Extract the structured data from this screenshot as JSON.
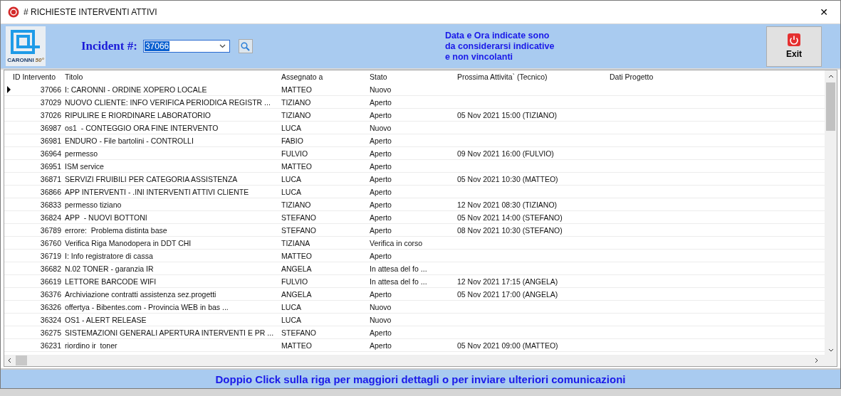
{
  "window": {
    "title": "# RICHIESTE INTERVENTI ATTIVI",
    "close": "✕"
  },
  "header": {
    "logo_text": "CARONNI",
    "logo_badge": "50°",
    "incident_label": "Incident #:",
    "incident_value": "37066",
    "notice": [
      "Data e Ora indicate sono",
      "da considerarsi indicative",
      "e non vincolanti"
    ],
    "exit_label": "Exit"
  },
  "table": {
    "columns": [
      "ID Intervento",
      "Titolo",
      "Assegnato a",
      "Stato",
      "Prossima Attivita` (Tecnico)",
      "Dati Progetto"
    ],
    "rows": [
      {
        "id": "37066",
        "title": "I: CARONNI - ORDINE XOPERO LOCALE",
        "assigned": "MATTEO",
        "state": "Nuovo",
        "next": "",
        "selected": true
      },
      {
        "id": "37029",
        "title": "NUOVO CLIENTE: INFO VERIFICA PERIODICA REGISTR ...",
        "assigned": "TIZIANO",
        "state": "Aperto",
        "next": "",
        "selected": false
      },
      {
        "id": "37026",
        "title": "RIPULIRE E RIORDINARE LABORATORIO",
        "assigned": "TIZIANO",
        "state": "Aperto",
        "next": "05 Nov 2021 15:00 (TIZIANO)",
        "selected": false
      },
      {
        "id": "36987",
        "title": "os1  - CONTEGGIO ORA FINE INTERVENTO",
        "assigned": "LUCA",
        "state": "Nuovo",
        "next": "",
        "selected": false
      },
      {
        "id": "36981",
        "title": "ENDURO - File bartolini - CONTROLLI",
        "assigned": "FABIO",
        "state": "Aperto",
        "next": "",
        "selected": false
      },
      {
        "id": "36964",
        "title": "permesso",
        "assigned": "FULVIO",
        "state": "Aperto",
        "next": "09 Nov 2021 16:00 (FULVIO)",
        "selected": false
      },
      {
        "id": "36951",
        "title": "ISM service",
        "assigned": "MATTEO",
        "state": "Aperto",
        "next": "",
        "selected": false
      },
      {
        "id": "36871",
        "title": "SERVIZI FRUIBILI PER CATEGORIA ASSISTENZA",
        "assigned": "LUCA",
        "state": "Aperto",
        "next": "05 Nov 2021 10:30 (MATTEO)",
        "selected": false
      },
      {
        "id": "36866",
        "title": "APP INTERVENTI - .INI INTERVENTI ATTIVI CLIENTE",
        "assigned": "LUCA",
        "state": "Aperto",
        "next": "",
        "selected": false
      },
      {
        "id": "36833",
        "title": "permesso tiziano",
        "assigned": "TIZIANO",
        "state": "Aperto",
        "next": "12 Nov 2021 08:30 (TIZIANO)",
        "selected": false
      },
      {
        "id": "36824",
        "title": "APP  - NUOVI BOTTONI",
        "assigned": "STEFANO",
        "state": "Aperto",
        "next": "05 Nov 2021 14:00 (STEFANO)",
        "selected": false
      },
      {
        "id": "36789",
        "title": "errore:  Problema distinta base",
        "assigned": "STEFANO",
        "state": "Aperto",
        "next": "08 Nov 2021 10:30 (STEFANO)",
        "selected": false
      },
      {
        "id": "36760",
        "title": "Verifica Riga Manodopera in DDT CHI",
        "assigned": "TIZIANA",
        "state": "Verifica in corso",
        "next": "",
        "selected": false
      },
      {
        "id": "36719",
        "title": "I: Info registratore di cassa",
        "assigned": "MATTEO",
        "state": "Aperto",
        "next": "",
        "selected": false
      },
      {
        "id": "36682",
        "title": "N.02 TONER - garanzia IR",
        "assigned": "ANGELA",
        "state": "In attesa del fo ...",
        "next": "",
        "selected": false
      },
      {
        "id": "36619",
        "title": "LETTORE BARCODE WIFI",
        "assigned": "FULVIO",
        "state": "In attesa del fo ...",
        "next": "12 Nov 2021 17:15 (ANGELA)",
        "selected": false
      },
      {
        "id": "36376",
        "title": "Archiviazione contratti assistenza sez.progetti",
        "assigned": "ANGELA",
        "state": "Aperto",
        "next": "05 Nov 2021 17:00 (ANGELA)",
        "selected": false
      },
      {
        "id": "36326",
        "title": "offertya - Bibentes.com - Provincia WEB in bas ...",
        "assigned": "LUCA",
        "state": "Nuovo",
        "next": "",
        "selected": false
      },
      {
        "id": "36324",
        "title": "OS1 - ALERT RELEASE",
        "assigned": "LUCA",
        "state": "Nuovo",
        "next": "",
        "selected": false
      },
      {
        "id": "36275",
        "title": "SISTEMAZIONI GENERALI APERTURA INTERVENTI E PR ...",
        "assigned": "STEFANO",
        "state": "Aperto",
        "next": "",
        "selected": false
      },
      {
        "id": "36231",
        "title": "riordino ir  toner",
        "assigned": "MATTEO",
        "state": "Aperto",
        "next": "05 Nov 2021 09:00 (MATTEO)",
        "selected": false
      }
    ]
  },
  "footer": {
    "message": "Doppio Click sulla riga per maggiori dettagli o per  inviare ulteriori comunicazioni"
  }
}
